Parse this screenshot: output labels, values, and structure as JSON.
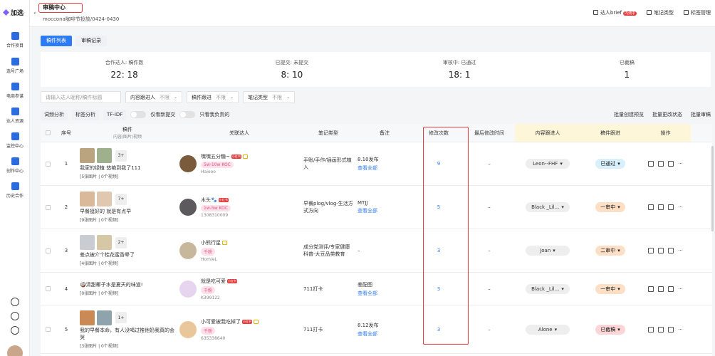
{
  "brand": {
    "name": "加选"
  },
  "sidebar": {
    "items": [
      {
        "label": "合作项目"
      },
      {
        "label": "选号广场"
      },
      {
        "label": "电商参谋"
      },
      {
        "label": "达人资源"
      },
      {
        "label": "监控中心"
      },
      {
        "label": "创作中心"
      },
      {
        "label": "历史合作"
      }
    ]
  },
  "header": {
    "title": "审稿中心",
    "subtitle": "moccona咖啡节投放/0424-0430",
    "actions": [
      {
        "label": "达人brief",
        "badge": "内测中"
      },
      {
        "label": "笔记类型"
      },
      {
        "label": "标签管理"
      }
    ]
  },
  "tabs": [
    {
      "label": "稿件列表"
    },
    {
      "label": "审稿记录"
    }
  ],
  "stats": [
    {
      "label": "合作达人: 稿件数",
      "value": "22: 18"
    },
    {
      "label": "已提交: 未提交",
      "value": "8: 10"
    },
    {
      "label": "审核中: 已通过",
      "value": "18: 1"
    },
    {
      "label": "已截稿",
      "value": "1"
    }
  ],
  "filters": {
    "search_placeholder": "请输入达人昵称/稿件标题",
    "f1_label": "内容跟进人",
    "f1_value": "不限",
    "f2_label": "稿件跟进",
    "f2_value": "不限",
    "f3_label": "笔记类型",
    "f3_value": "不限"
  },
  "toolbar": {
    "b1": "词频分析",
    "b2": "标签分析",
    "b3": "TF-IDF",
    "t1": "仅看新提交",
    "t2": "只看我负责的",
    "r1": "批量创建预览",
    "r2": "批量更改状态",
    "r3": "批量审稿"
  },
  "columns": {
    "seq": "序号",
    "work": "稿件",
    "work_sub": "内容/图片/视频",
    "kol": "关联达人",
    "type": "笔记类型",
    "note": "备注",
    "edits": "修改次数",
    "last": "最后修改时间",
    "owner": "内容跟进人",
    "follow": "稿件跟进",
    "ops": "操作"
  },
  "rows": [
    {
      "seq": "1",
      "more": "3+",
      "title": "我家的绿植 悠艳到我了111",
      "media": "[5张图片 | 0个视频]",
      "kol_name": "嘿嘿五分糖~",
      "kol_tag": "5w-10w KOC",
      "kol_id": "Haiooo",
      "type": "手账/手作/插画形式植入",
      "note": "8.10发布",
      "note_link": "查看全部",
      "edits": "9",
      "last": "–",
      "owner": "Leon--FHF",
      "follow": "已通过",
      "follow_style": "blue"
    },
    {
      "seq": "2",
      "more": "7+",
      "title": "早餐挺好的 就是有点早",
      "media": "[9张图片 | 0个视频]",
      "kol_name": "木头🐾",
      "kol_tag": "1w-5w KOC",
      "kol_id": "1308310009",
      "type": "早餐plog/vlog-生活方式方向",
      "note": "MTJJ",
      "note_link": "查看全部",
      "edits": "5",
      "last": "–",
      "owner": "Black _Lil...",
      "follow": "一审中",
      "follow_style": "orange"
    },
    {
      "seq": "3",
      "more": "2+",
      "title": "差点被介个桂花蜜香晕了",
      "media": "[4张图片 | 0个视频]",
      "kol_name": "小熊行星",
      "kol_tag": "千粉",
      "kol_id": "HomieL",
      "type": "成分党测评/专家健康科普-大豆品类教育",
      "note": "–",
      "note_link": "",
      "edits": "3",
      "last": "–",
      "owner": "Joan",
      "follow": "二审中",
      "follow_style": "orange"
    },
    {
      "seq": "4",
      "more": "",
      "title": "🥥清甜椰子水是夏天的味道!",
      "media": "[0张图片 | 0个视频]",
      "kol_name": "就是吃可爱",
      "kol_tag": "千粉",
      "kol_id": "K399122",
      "type": "711打卡",
      "note": "差配图",
      "note_link": "查看全部",
      "edits": "3",
      "last": "–",
      "owner": "Black _Lil...",
      "follow": "一审中",
      "follow_style": "orange"
    },
    {
      "seq": "5",
      "more": "1+",
      "title": "我的早餐本命，有人没喝过推他奶我真的会哭",
      "media": "[3张图片 | 0个视频]",
      "kol_name": "小可爱被我吃掉了",
      "kol_tag": "千粉",
      "kol_id": "635338640",
      "type": "711打卡",
      "note": "8.12发布",
      "note_link": "查看全部",
      "edits": "3",
      "last": "–",
      "owner": "Alone",
      "follow": "已截稿",
      "follow_style": "red"
    }
  ],
  "colors": {
    "accent": "#2d7cf6",
    "highlight": "#e23b3b"
  }
}
